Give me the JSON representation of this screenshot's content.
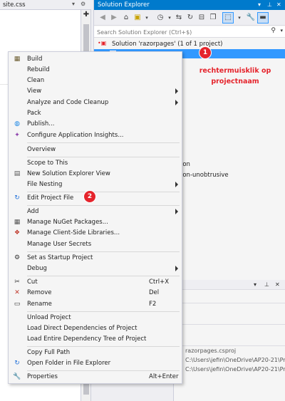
{
  "left_tab": {
    "title": "site.css",
    "dropdown_icon": "▾",
    "settings_icon": "⚙"
  },
  "solution_explorer": {
    "title": "Solution Explorer",
    "search_placeholder": "Search Solution Explorer (Ctrl+$)",
    "solution_label": "Solution 'razorpages' (1 of 1 project)",
    "partial_items": [
      "ion",
      "ion-unobtrusive"
    ],
    "annotation": "rechtermuisklik op projectnaam",
    "badge_1": "1"
  },
  "properties_panel": {
    "value_1": "razorpages.csproj",
    "value_2": "C:\\Users\\jefin\\OneDrive\\AP20-21\\Pro",
    "value_3": "C:\\Users\\jefin\\OneDrive\\AP20-21\\Pro"
  },
  "context_menu": {
    "badge_2": "2",
    "items": {
      "build": "Build",
      "rebuild": "Rebuild",
      "clean": "Clean",
      "view": "View",
      "analyze": "Analyze and Code Cleanup",
      "pack": "Pack",
      "publish": "Publish...",
      "configure": "Configure Application Insights...",
      "overview": "Overview",
      "scope": "Scope to This",
      "new_view": "New Solution Explorer View",
      "file_nesting": "File Nesting",
      "edit_project": "Edit Project File",
      "add": "Add",
      "nuget": "Manage NuGet Packages...",
      "client_libs": "Manage Client-Side Libraries...",
      "user_secrets": "Manage User Secrets",
      "startup": "Set as Startup Project",
      "debug": "Debug",
      "cut": "Cut",
      "cut_shortcut": "Ctrl+X",
      "remove": "Remove",
      "remove_shortcut": "Del",
      "rename": "Rename",
      "rename_shortcut": "F2",
      "unload": "Unload Project",
      "load_direct": "Load Direct Dependencies of Project",
      "load_tree": "Load Entire Dependency Tree of Project",
      "copy_path": "Copy Full Path",
      "open_folder": "Open Folder in File Explorer",
      "properties": "Properties",
      "properties_shortcut": "Alt+Enter"
    }
  }
}
